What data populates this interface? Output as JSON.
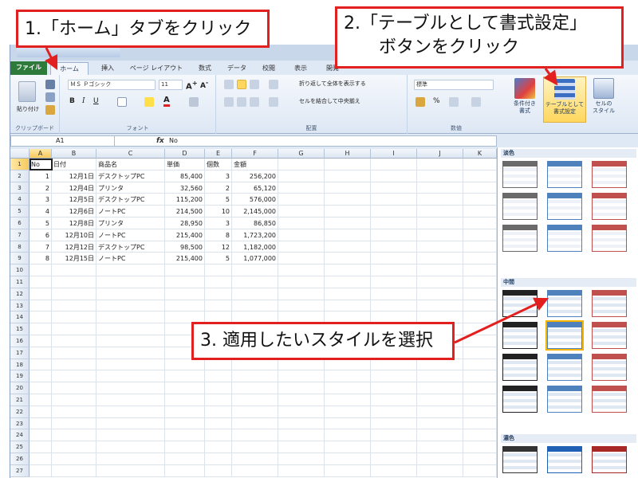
{
  "ribbon": {
    "tabs": [
      "ファイル",
      "ホーム",
      "挿入",
      "ページ レイアウト",
      "数式",
      "データ",
      "校閲",
      "表示",
      "開発"
    ],
    "font_name": "ＭＳ Ｐゴシック",
    "font_size": "11",
    "clipboard_label": "クリップボード",
    "font_label": "フォント",
    "align_label": "配置",
    "number_label": "数値",
    "paste_label": "貼り付け",
    "wrap_text": "折り返して全体を表示する",
    "merge_center": "セルを結合して中央揃え",
    "number_format": "標準",
    "conditional_format": "条件付き\n書式",
    "format_as_table": "テーブルとして\n書式設定",
    "cell_styles": "セルの\nスタイル"
  },
  "formula_bar": {
    "cell_ref": "A1",
    "fx": "fx",
    "value": "No"
  },
  "grid": {
    "columns": [
      "A",
      "B",
      "C",
      "D",
      "E",
      "F",
      "G",
      "H",
      "I",
      "J",
      "K"
    ],
    "headers": [
      "No",
      "日付",
      "商品名",
      "単価",
      "個数",
      "金額"
    ],
    "rows": [
      [
        "1",
        "12月1日",
        "デスクトップPC",
        "85,400",
        "3",
        "256,200"
      ],
      [
        "2",
        "12月4日",
        "プリンタ",
        "32,560",
        "2",
        "65,120"
      ],
      [
        "3",
        "12月5日",
        "デスクトップPC",
        "115,200",
        "5",
        "576,000"
      ],
      [
        "4",
        "12月6日",
        "ノートPC",
        "214,500",
        "10",
        "2,145,000"
      ],
      [
        "5",
        "12月8日",
        "プリンタ",
        "28,950",
        "3",
        "86,850"
      ],
      [
        "6",
        "12月10日",
        "ノートPC",
        "215,400",
        "8",
        "1,723,200"
      ],
      [
        "7",
        "12月12日",
        "デスクトップPC",
        "98,500",
        "12",
        "1,182,000"
      ],
      [
        "8",
        "12月15日",
        "ノートPC",
        "215,400",
        "5",
        "1,077,000"
      ]
    ],
    "row_numbers": [
      "1",
      "2",
      "3",
      "4",
      "5",
      "6",
      "7",
      "8",
      "9",
      "10",
      "11",
      "12",
      "13",
      "14",
      "15",
      "16",
      "17",
      "18",
      "19",
      "20",
      "21",
      "22",
      "23",
      "24",
      "25",
      "26",
      "27"
    ]
  },
  "gallery": {
    "sections": [
      "淡色",
      "中間",
      "濃色"
    ]
  },
  "callouts": {
    "step1": "1.「ホーム」タブをクリック",
    "step2_line1": "2.「テーブルとして書式設定」",
    "step2_line2": "ボタンをクリック",
    "step3": "3. 適用したいスタイルを選択"
  },
  "colors": {
    "accent_red": "#e32020",
    "file_tab": "#2e7a3a",
    "highlight": "#ffd75e"
  }
}
